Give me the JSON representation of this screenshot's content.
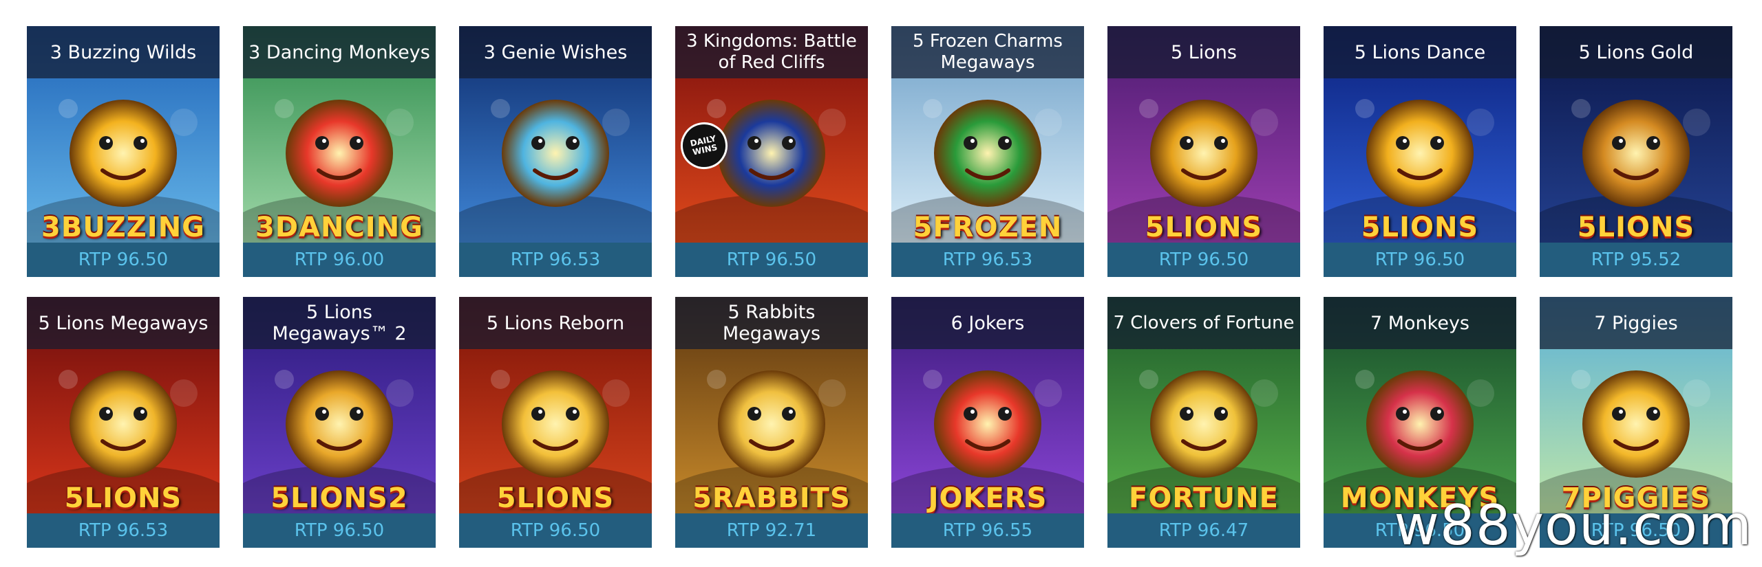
{
  "games": [
    {
      "title": "3 Buzzing Wilds",
      "rtp": "RTP 96.50",
      "logo": "3BUZZING",
      "bg": [
        "#1e63b8",
        "#66b6e8"
      ],
      "accent": "#f3b21f"
    },
    {
      "title": "3 Dancing Monkeys",
      "rtp": "RTP 96.00",
      "logo": "3DANCING",
      "bg": [
        "#2b8a4a",
        "#9fd8a8"
      ],
      "accent": "#e8382a"
    },
    {
      "title": "3 Genie Wishes",
      "rtp": "RTP 96.53",
      "logo": "",
      "bg": [
        "#0d2a6b",
        "#3f86d6"
      ],
      "accent": "#4fb4e0"
    },
    {
      "title": "3 Kingdoms: Battle of Red Cliffs",
      "rtp": "RTP 96.50",
      "logo": "",
      "bg": [
        "#7a0d0d",
        "#e04a1b"
      ],
      "accent": "#1b3a9c",
      "badge": "DAILY WINS"
    },
    {
      "title": "5 Frozen Charms Megaways",
      "rtp": "RTP 96.53",
      "logo": "5FROZEN",
      "bg": [
        "#6ea0c8",
        "#d9ecf7"
      ],
      "accent": "#2a9b3a"
    },
    {
      "title": "5 Lions",
      "rtp": "RTP 96.50",
      "logo": "5LIONS",
      "bg": [
        "#4a1a6e",
        "#9c3fb0"
      ],
      "accent": "#e6a21c"
    },
    {
      "title": "5 Lions Dance",
      "rtp": "RTP 96.50",
      "logo": "5LIONS",
      "bg": [
        "#0a1f7a",
        "#2f5fd6"
      ],
      "accent": "#f2b01e"
    },
    {
      "title": "5 Lions Gold",
      "rtp": "RTP 95.52",
      "logo": "5LIONS",
      "bg": [
        "#0b1648",
        "#23408f"
      ],
      "accent": "#d58b22"
    },
    {
      "title": "5 Lions Megaways",
      "rtp": "RTP 96.53",
      "logo": "5LIONS",
      "bg": [
        "#6a0c0c",
        "#d8361a"
      ],
      "accent": "#f0b52a"
    },
    {
      "title": "5 Lions Megaways™ 2",
      "rtp": "RTP 96.50",
      "logo": "5LIONS2",
      "bg": [
        "#2a1a7a",
        "#6a3fc8"
      ],
      "accent": "#e9a82a"
    },
    {
      "title": "5 Lions Reborn",
      "rtp": "RTP 96.50",
      "logo": "5LIONS",
      "bg": [
        "#7a1208",
        "#d6431c"
      ],
      "accent": "#f3c03a"
    },
    {
      "title": "5 Rabbits Megaways",
      "rtp": "RTP 92.71",
      "logo": "5RABBITS",
      "bg": [
        "#5a3510",
        "#c88a2a"
      ],
      "accent": "#f0c040"
    },
    {
      "title": "6 Jokers",
      "rtp": "RTP 96.55",
      "logo": "JOKERS",
      "bg": [
        "#3b1a7a",
        "#8a45d6"
      ],
      "accent": "#e8382a"
    },
    {
      "title": "7 Clovers of Fortune",
      "rtp": "RTP 96.47",
      "logo": "FORTUNE",
      "bg": [
        "#1d5a2a",
        "#58b04a"
      ],
      "accent": "#f0c23a"
    },
    {
      "title": "7 Monkeys",
      "rtp": "RTP 96.50",
      "logo": "MONKEYS",
      "bg": [
        "#164a2a",
        "#4aa24a"
      ],
      "accent": "#d6324a"
    },
    {
      "title": "7 Piggies",
      "rtp": "RTP 96.50",
      "logo": "7PIGGIES",
      "bg": [
        "#5ab0d8",
        "#bfe6a8"
      ],
      "accent": "#f3b82a"
    }
  ],
  "watermark": "w88you.com"
}
